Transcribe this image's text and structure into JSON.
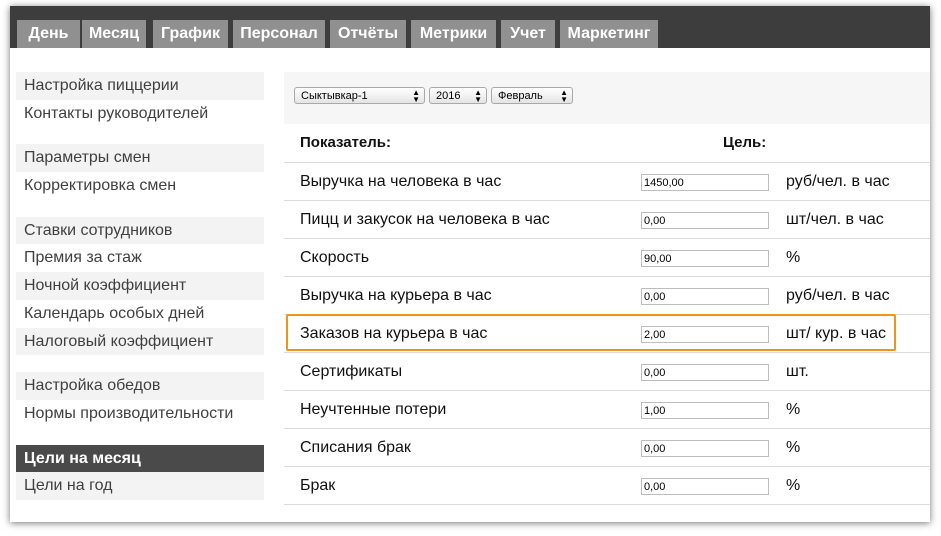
{
  "nav": {
    "tabs": [
      {
        "label": "День"
      },
      {
        "label": "Месяц"
      },
      {
        "label": "График"
      },
      {
        "label": "Персонал"
      },
      {
        "label": "Отчёты"
      },
      {
        "label": "Метрики"
      },
      {
        "label": "Учет"
      },
      {
        "label": "Маркетинг"
      }
    ]
  },
  "sidebar": {
    "groups": [
      {
        "items": [
          {
            "label": "Настройка пиццерии"
          },
          {
            "label": "Контакты руководителей"
          }
        ]
      },
      {
        "items": [
          {
            "label": "Параметры смен"
          },
          {
            "label": "Корректировка смен"
          }
        ]
      },
      {
        "items": [
          {
            "label": "Ставки сотрудников"
          },
          {
            "label": "Премия за стаж"
          },
          {
            "label": "Ночной коэффициент"
          },
          {
            "label": "Календарь особых дней"
          },
          {
            "label": "Налоговый коэффициент"
          }
        ]
      },
      {
        "items": [
          {
            "label": "Настройка обедов"
          },
          {
            "label": "Нормы производительности"
          }
        ]
      },
      {
        "items": [
          {
            "label": "Цели на месяц",
            "active": true
          },
          {
            "label": "Цели на год"
          }
        ]
      }
    ]
  },
  "filters": {
    "city": "Сыктывкар-1",
    "year": "2016",
    "month": "Февраль"
  },
  "table": {
    "header_indicator": "Показатель:",
    "header_target": "Цель:",
    "rows": [
      {
        "label": "Выручка на человека в час",
        "value": "1450,00",
        "unit": "руб/чел. в час"
      },
      {
        "label": "Пицц и закусок на человека в час",
        "value": "0,00",
        "unit": "шт/чел. в час"
      },
      {
        "label": "Скорость",
        "value": "90,00",
        "unit": "%"
      },
      {
        "label": "Выручка на курьера в час",
        "value": "0,00",
        "unit": "руб/чел. в час"
      },
      {
        "label": "Заказов на курьера в час",
        "value": "2,00",
        "unit": "шт/ кур. в час",
        "highlighted": true
      },
      {
        "label": "Сертификаты",
        "value": "0,00",
        "unit": "шт."
      },
      {
        "label": "Неучтенные потери",
        "value": "1,00",
        "unit": "%"
      },
      {
        "label": "Списания брак",
        "value": "0,00",
        "unit": "%"
      },
      {
        "label": "Брак",
        "value": "0,00",
        "unit": "%"
      }
    ]
  },
  "colors": {
    "topbar": "#3d3d3d",
    "tab": "#909090",
    "active_sidebar": "#4a4a4a",
    "highlight_border": "#f0941c"
  }
}
